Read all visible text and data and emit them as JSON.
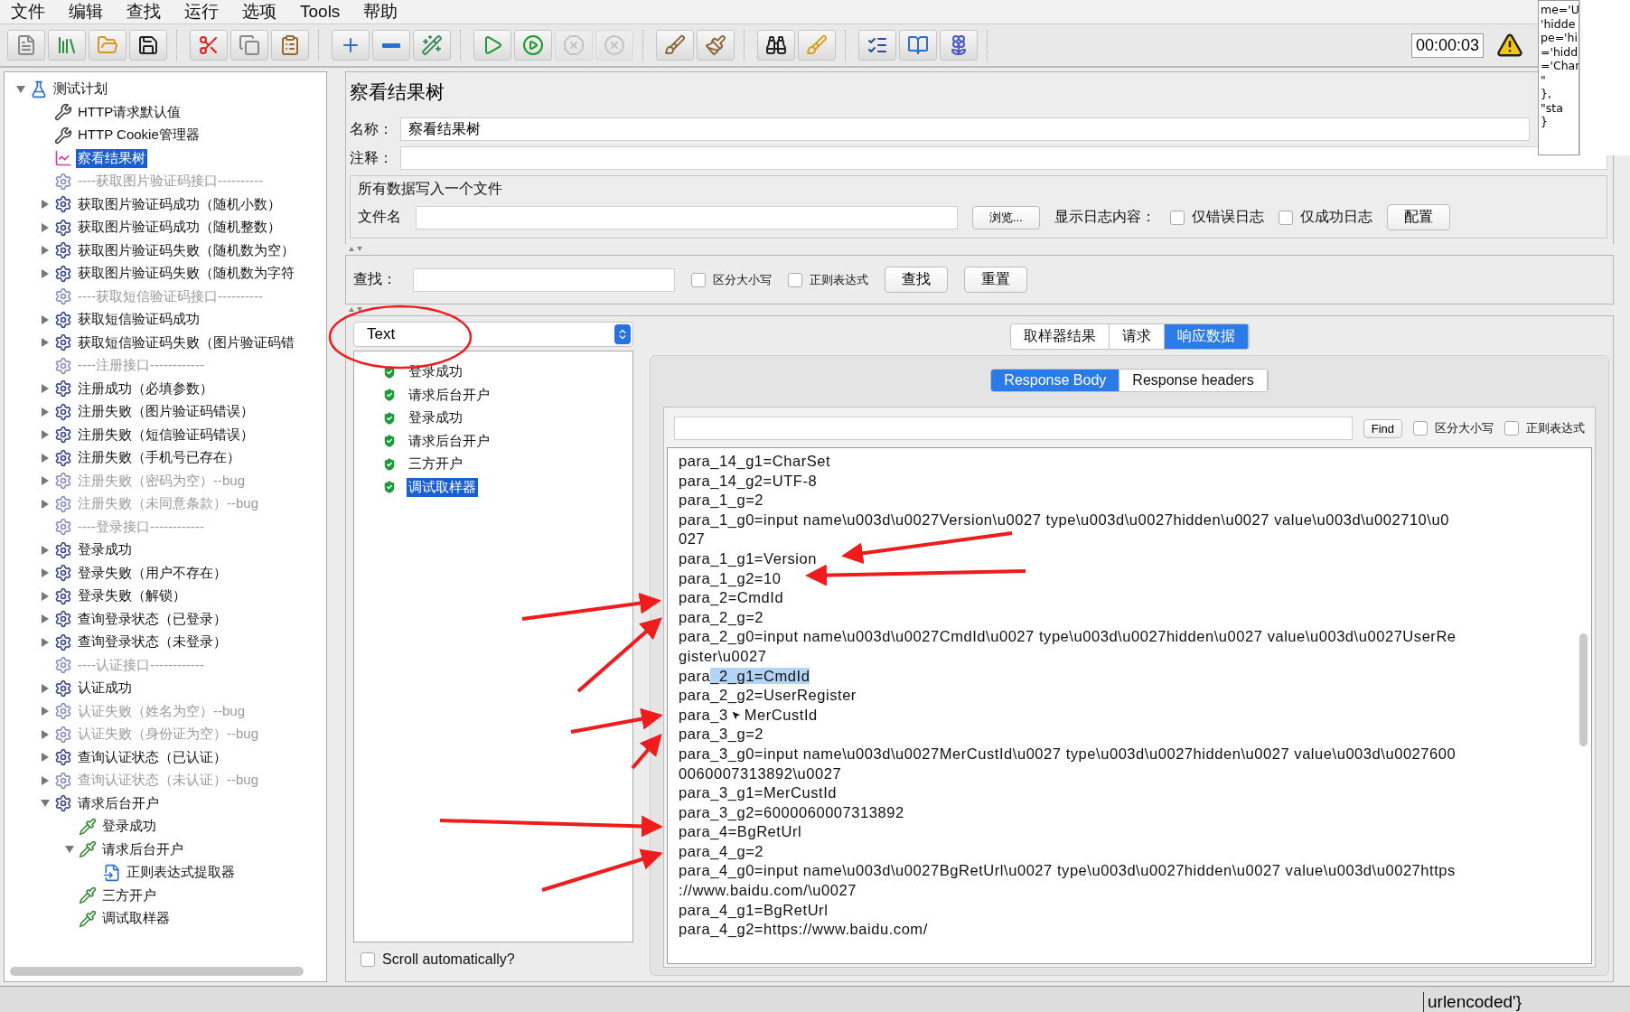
{
  "menu": [
    "文件",
    "编辑",
    "查找",
    "运行",
    "选项",
    "Tools",
    "帮助"
  ],
  "toolbar": [
    [
      {
        "disabled": false
      },
      {
        "disabled": false
      },
      {
        "disabled": false
      },
      {
        "disabled": false
      }
    ],
    [
      {
        "disabled": false
      },
      {
        "disabled": false
      },
      {
        "disabled": false
      }
    ],
    [
      {
        "disabled": false
      },
      {
        "disabled": false
      },
      {
        "disabled": false
      }
    ],
    [
      {
        "disabled": false
      },
      {
        "disabled": false
      },
      {
        "disabled": true
      },
      {
        "disabled": true
      }
    ],
    [
      {
        "disabled": false
      },
      {
        "disabled": false
      }
    ],
    [
      {
        "disabled": false
      },
      {
        "disabled": false
      }
    ],
    [
      {
        "disabled": false
      },
      {
        "disabled": false
      },
      {
        "disabled": false
      }
    ]
  ],
  "timer": "00:00:03",
  "background_popup": [
    "me='U",
    "'hidde",
    "pe='hi",
    "='hidd",
    "='Char",
    "\"",
    "},",
    "\"sta",
    "}"
  ],
  "tree": [
    {
      "label": "测试计划",
      "kind": "plan",
      "expandable": true,
      "expanded": true,
      "disabled": false,
      "selected": false,
      "children": [
        {
          "label": "HTTP请求默认值",
          "kind": "config",
          "expandable": false,
          "expanded": false,
          "disabled": false,
          "selected": false
        },
        {
          "label": "HTTP Cookie管理器",
          "kind": "config",
          "expandable": false,
          "expanded": false,
          "disabled": false,
          "selected": false
        },
        {
          "label": "察看结果树",
          "kind": "listener",
          "expandable": false,
          "expanded": false,
          "disabled": false,
          "selected": true
        },
        {
          "label": "----获取图片验证码接口----------",
          "kind": "thread",
          "expandable": false,
          "expanded": false,
          "disabled": true,
          "selected": false
        },
        {
          "label": "获取图片验证码成功（随机小数）",
          "kind": "thread",
          "expandable": true,
          "expanded": false,
          "disabled": false,
          "selected": false
        },
        {
          "label": "获取图片验证码成功（随机整数）",
          "kind": "thread",
          "expandable": true,
          "expanded": false,
          "disabled": false,
          "selected": false
        },
        {
          "label": "获取图片验证码失败（随机数为空）",
          "kind": "thread",
          "expandable": true,
          "expanded": false,
          "disabled": false,
          "selected": false
        },
        {
          "label": "获取图片验证码失败（随机数为字符",
          "kind": "thread",
          "expandable": true,
          "expanded": false,
          "disabled": false,
          "selected": false
        },
        {
          "label": "----获取短信验证码接口----------",
          "kind": "thread",
          "expandable": false,
          "expanded": false,
          "disabled": true,
          "selected": false
        },
        {
          "label": "获取短信验证码成功",
          "kind": "thread",
          "expandable": true,
          "expanded": false,
          "disabled": false,
          "selected": false
        },
        {
          "label": "获取短信验证码失败（图片验证码错",
          "kind": "thread",
          "expandable": true,
          "expanded": false,
          "disabled": false,
          "selected": false
        },
        {
          "label": "----注册接口------------",
          "kind": "thread",
          "expandable": false,
          "expanded": false,
          "disabled": true,
          "selected": false
        },
        {
          "label": "注册成功（必填参数）",
          "kind": "thread",
          "expandable": true,
          "expanded": false,
          "disabled": false,
          "selected": false
        },
        {
          "label": "注册失败（图片验证码错误）",
          "kind": "thread",
          "expandable": true,
          "expanded": false,
          "disabled": false,
          "selected": false
        },
        {
          "label": "注册失败（短信验证码错误）",
          "kind": "thread",
          "expandable": true,
          "expanded": false,
          "disabled": false,
          "selected": false
        },
        {
          "label": "注册失败（手机号已存在）",
          "kind": "thread",
          "expandable": true,
          "expanded": false,
          "disabled": false,
          "selected": false
        },
        {
          "label": "注册失败（密码为空）--bug",
          "kind": "thread",
          "expandable": true,
          "expanded": false,
          "disabled": true,
          "selected": false
        },
        {
          "label": "注册失败（未同意条款）--bug",
          "kind": "thread",
          "expandable": true,
          "expanded": false,
          "disabled": true,
          "selected": false
        },
        {
          "label": "----登录接口------------",
          "kind": "thread",
          "expandable": false,
          "expanded": false,
          "disabled": true,
          "selected": false
        },
        {
          "label": "登录成功",
          "kind": "thread",
          "expandable": true,
          "expanded": false,
          "disabled": false,
          "selected": false
        },
        {
          "label": "登录失败（用户不存在）",
          "kind": "thread",
          "expandable": true,
          "expanded": false,
          "disabled": false,
          "selected": false
        },
        {
          "label": "登录失败（解锁）",
          "kind": "thread",
          "expandable": true,
          "expanded": false,
          "disabled": false,
          "selected": false
        },
        {
          "label": "查询登录状态（已登录）",
          "kind": "thread",
          "expandable": true,
          "expanded": false,
          "disabled": false,
          "selected": false
        },
        {
          "label": "查询登录状态（未登录）",
          "kind": "thread",
          "expandable": true,
          "expanded": false,
          "disabled": false,
          "selected": false
        },
        {
          "label": "----认证接口------------",
          "kind": "thread",
          "expandable": false,
          "expanded": false,
          "disabled": true,
          "selected": false
        },
        {
          "label": "认证成功",
          "kind": "thread",
          "expandable": true,
          "expanded": false,
          "disabled": false,
          "selected": false
        },
        {
          "label": "认证失败（姓名为空）--bug",
          "kind": "thread",
          "expandable": true,
          "expanded": false,
          "disabled": true,
          "selected": false
        },
        {
          "label": "认证失败（身份证为空）--bug",
          "kind": "thread",
          "expandable": true,
          "expanded": false,
          "disabled": true,
          "selected": false
        },
        {
          "label": "查询认证状态（已认证）",
          "kind": "thread",
          "expandable": true,
          "expanded": false,
          "disabled": false,
          "selected": false
        },
        {
          "label": "查询认证状态（未认证）--bug",
          "kind": "thread",
          "expandable": true,
          "expanded": false,
          "disabled": true,
          "selected": false
        },
        {
          "label": "请求后台开户",
          "kind": "thread",
          "expandable": true,
          "expanded": true,
          "disabled": false,
          "selected": false,
          "children": [
            {
              "label": "登录成功",
              "kind": "sampler",
              "expandable": false,
              "expanded": false,
              "disabled": false,
              "selected": false
            },
            {
              "label": "请求后台开户",
              "kind": "sampler",
              "expandable": true,
              "expanded": true,
              "disabled": false,
              "selected": false,
              "children": [
                {
                  "label": "正则表达式提取器",
                  "kind": "extractor",
                  "expandable": false,
                  "expanded": false,
                  "disabled": false,
                  "selected": false
                }
              ]
            },
            {
              "label": "三方开户",
              "kind": "sampler",
              "expandable": false,
              "expanded": false,
              "disabled": false,
              "selected": false
            },
            {
              "label": "调试取样器",
              "kind": "sampler",
              "expandable": false,
              "expanded": false,
              "disabled": false,
              "selected": false
            }
          ]
        }
      ]
    }
  ],
  "panel": {
    "title": "察看结果树",
    "name_label": "名称：",
    "name_value": "察看结果树",
    "comment_label": "注释：",
    "file_group": {
      "legend": "所有数据写入一个文件",
      "file_label": "文件名",
      "browse_button": "浏览...",
      "log_label": "显示日志内容：",
      "checks": [
        {
          "label": "仅错误日志",
          "checked": false
        },
        {
          "label": "仅成功日志",
          "checked": false
        }
      ],
      "config_button": "配置"
    },
    "search": {
      "label": "查找：",
      "checks": [
        {
          "label": "区分大小写",
          "checked": false
        },
        {
          "label": "正则表达式",
          "checked": false
        }
      ],
      "buttons": [
        "查找",
        "重置"
      ]
    },
    "renderer": "Text",
    "results": [
      {
        "label": "登录成功",
        "kind": "success",
        "selected": false
      },
      {
        "label": "请求后台开户",
        "kind": "success",
        "selected": false
      },
      {
        "label": "登录成功",
        "kind": "success",
        "selected": false
      },
      {
        "label": "请求后台开户",
        "kind": "success",
        "selected": false
      },
      {
        "label": "三方开户",
        "kind": "success",
        "selected": false
      },
      {
        "label": "调试取样器",
        "kind": "success",
        "selected": true
      }
    ],
    "scroll_auto": {
      "label": "Scroll automatically?",
      "checked": false
    },
    "tabs": [
      {
        "label": "取样器结果",
        "selected": false
      },
      {
        "label": "请求",
        "selected": false
      },
      {
        "label": "响应数据",
        "selected": true
      }
    ],
    "subtabs": [
      {
        "label": "Response Body",
        "selected": true
      },
      {
        "label": "Response headers",
        "selected": false
      }
    ],
    "find": {
      "button": "Find",
      "checks": [
        {
          "label": "区分大小写",
          "checked": false
        },
        {
          "label": "正则表达式",
          "checked": false
        }
      ]
    },
    "lines": [
      {
        "text": "para_14_g1=CharSet"
      },
      {
        "text": "para_14_g2=UTF-8"
      },
      {
        "text": "para_1_g=2"
      },
      {
        "text": "para_1_g0=input name\\u003d\\u0027Version\\u0027 type\\u003d\\u0027hidden\\u0027 value\\u003d\\u002710\\u0"
      },
      {
        "text": "027"
      },
      {
        "text": "para_1_g1=Version"
      },
      {
        "text": "para_1_g2=10"
      },
      {
        "text": "para_2=CmdId"
      },
      {
        "text": "para_2_g=2"
      },
      {
        "text": "para_2_g0=input name\\u003d\\u0027CmdId\\u0027 type\\u003d\\u0027hidden\\u0027 value\\u003d\\u0027UserRe"
      },
      {
        "text": "gister\\u0027"
      },
      {
        "text": "para",
        "selection": "_2_g1=CmdId"
      },
      {
        "text": "para_2_g2=UserRegister"
      },
      {
        "text": "para_3",
        "after_cursor": "MerCustId"
      },
      {
        "text": "para_3_g=2"
      },
      {
        "text": "para_3_g0=input name\\u003d\\u0027MerCustId\\u0027 type\\u003d\\u0027hidden\\u0027 value\\u003d\\u0027600"
      },
      {
        "text": "0060007313892\\u0027"
      },
      {
        "text": "para_3_g1=MerCustId"
      },
      {
        "text": "para_3_g2=6000060007313892"
      },
      {
        "text": "para_4=BgRetUrl"
      },
      {
        "text": "para_4_g=2"
      },
      {
        "text": "para_4_g0=input name\\u003d\\u0027BgRetUrl\\u0027 type\\u003d\\u0027hidden\\u0027 value\\u003d\\u0027https"
      },
      {
        "text": "://www.baidu.com/\\u0027"
      },
      {
        "text": "para_4_g1=BgRetUrl"
      },
      {
        "text": "para_4_g2=https://www.baidu.com/"
      }
    ]
  },
  "bottom_strip": "urlencoded'}",
  "annotations": [
    {
      "kind": "circle"
    },
    {
      "kind": "arrow"
    },
    {
      "kind": "arrow"
    },
    {
      "kind": "arrow"
    },
    {
      "kind": "arrow"
    },
    {
      "kind": "arrow"
    },
    {
      "kind": "arrow"
    },
    {
      "kind": "arrow"
    },
    {
      "kind": "arrow"
    }
  ]
}
